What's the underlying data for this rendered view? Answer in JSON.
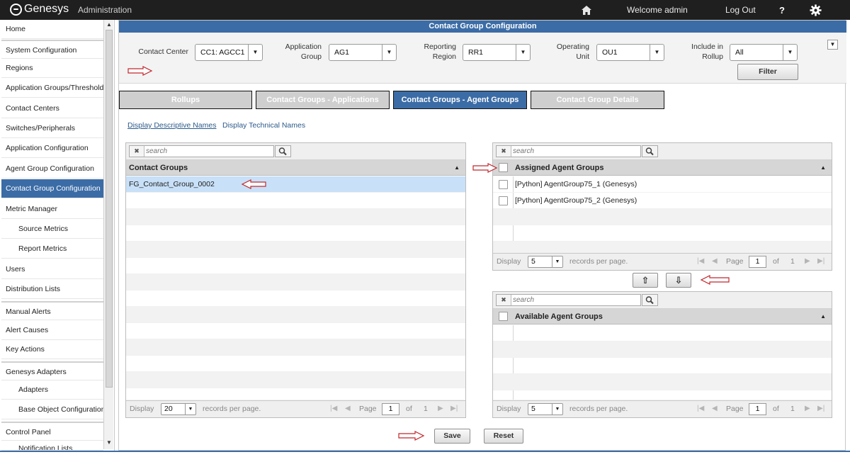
{
  "topbar": {
    "logo_text": "Genesys",
    "app_name": "Administration",
    "welcome": "Welcome  admin",
    "logout": "Log Out",
    "help": "?"
  },
  "sidebar": {
    "items": [
      {
        "label": "Home"
      },
      {
        "label": "System Configuration"
      },
      {
        "label": "Regions"
      },
      {
        "label": "Application Groups/Thresholds"
      },
      {
        "label": "Contact Centers"
      },
      {
        "label": "Switches/Peripherals"
      },
      {
        "label": "Application Configuration"
      },
      {
        "label": "Agent Group Configuration"
      },
      {
        "label": "Contact Group Configuration"
      },
      {
        "label": "Metric Manager"
      },
      {
        "label": "Source Metrics"
      },
      {
        "label": "Report Metrics"
      },
      {
        "label": "Users"
      },
      {
        "label": "Distribution Lists"
      },
      {
        "label": "Manual Alerts"
      },
      {
        "label": "Alert Causes"
      },
      {
        "label": "Key Actions"
      },
      {
        "label": "Genesys Adapters"
      },
      {
        "label": "Adapters"
      },
      {
        "label": "Base Object Configuration"
      },
      {
        "label": "Control Panel"
      },
      {
        "label": "Notification Lists"
      }
    ]
  },
  "page": {
    "title": "Contact Group Configuration"
  },
  "filters": {
    "contact_center_label": "Contact Center",
    "contact_center_value": "CC1: AGCC1",
    "app_group_label_1": "Application",
    "app_group_label_2": "Group",
    "app_group_value": "AG1",
    "region_label_1": "Reporting",
    "region_label_2": "Region",
    "region_value": "RR1",
    "unit_label_1": "Operating",
    "unit_label_2": "Unit",
    "unit_value": "OU1",
    "rollup_label_1": "Include in",
    "rollup_label_2": "Rollup",
    "rollup_value": "All",
    "filter_button": "Filter"
  },
  "tabs": [
    {
      "label": "Rollups"
    },
    {
      "label": "Contact Groups - Applications"
    },
    {
      "label": "Contact Groups - Agent Groups"
    },
    {
      "label": "Contact Group Details"
    }
  ],
  "links": {
    "descriptive": "Display Descriptive Names",
    "technical": "Display Technical Names"
  },
  "search_placeholder": "search",
  "contact_groups": {
    "header": "Contact Groups",
    "rows": [
      "FG_Contact_Group_0002"
    ],
    "footer": {
      "display": "Display",
      "per_page_value": "20",
      "records": "records per page.",
      "page": "Page",
      "page_value": "1",
      "of": "of",
      "total": "1"
    }
  },
  "assigned": {
    "header": "Assigned Agent Groups",
    "rows": [
      "[Python] AgentGroup75_1 (Genesys)",
      "[Python] AgentGroup75_2 (Genesys)"
    ],
    "footer": {
      "display": "Display",
      "per_page_value": "5",
      "records": "records per page.",
      "page": "Page",
      "page_value": "1",
      "of": "of",
      "total": "1"
    }
  },
  "available": {
    "header": "Available Agent Groups",
    "rows": [],
    "footer": {
      "display": "Display",
      "per_page_value": "5",
      "records": "records per page.",
      "page": "Page",
      "page_value": "1",
      "of": "of",
      "total": "1"
    }
  },
  "actions": {
    "save": "Save",
    "reset": "Reset"
  },
  "colors": {
    "accent": "#3b6ca6",
    "topbar": "#1f1f1f",
    "selected_row": "#c8e0f8",
    "annotation_arrow": "#c0282d"
  }
}
